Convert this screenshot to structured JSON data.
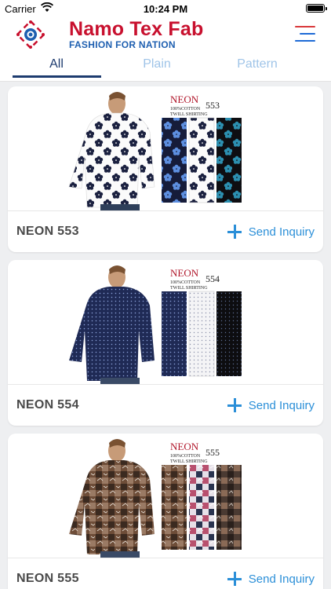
{
  "status_bar": {
    "carrier": "Carrier",
    "time": "10:24 PM"
  },
  "header": {
    "brand_name": "Namo Tex Fab",
    "tagline": "FASHION FOR NATION",
    "colors": {
      "brand_red": "#c8102e",
      "brand_blue": "#1e5fb0"
    }
  },
  "tabs": [
    {
      "label": "All",
      "active": true
    },
    {
      "label": "Plain",
      "active": false
    },
    {
      "label": "Pattern",
      "active": false
    }
  ],
  "products": [
    {
      "name": "NEON 553",
      "inquiry_label": "Send Inquiry",
      "image_text": {
        "brand": "NEON",
        "code": "553",
        "fabric": "100%COTTON",
        "weave": "TWILL SHIRTING"
      }
    },
    {
      "name": "NEON 554",
      "inquiry_label": "Send Inquiry",
      "image_text": {
        "brand": "NEON",
        "code": "554",
        "fabric": "100%COTTON",
        "weave": "TWILL SHIRTING"
      }
    },
    {
      "name": "NEON 555",
      "inquiry_label": "Send Inquiry",
      "image_text": {
        "brand": "NEON",
        "code": "555",
        "fabric": "100%COTTON",
        "weave": "TWILL SHIRTING"
      }
    }
  ]
}
